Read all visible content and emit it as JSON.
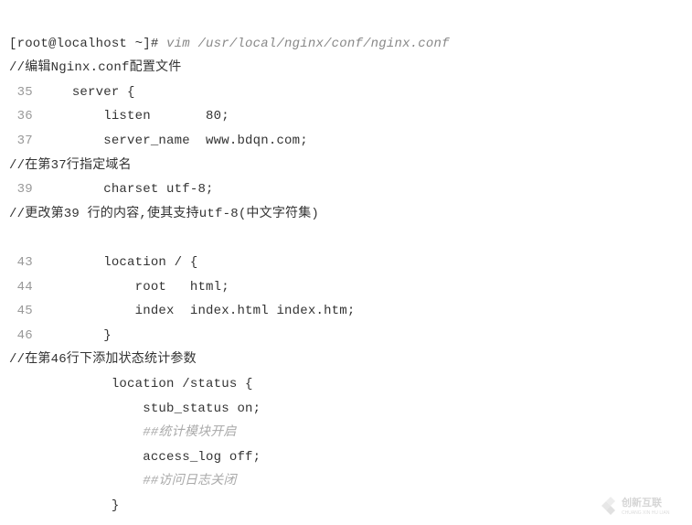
{
  "prompt": {
    "userHost": "[root@localhost ~]",
    "symbol": "#",
    "command": " vim /usr/local/nginx/conf/nginx.conf"
  },
  "comments": {
    "c1": "//编辑Nginx.conf配置文件",
    "c2": "//在第37行指定域名",
    "c3": "//更改第39 行的内容,使其支持utf-8(中文字符集)",
    "c4": "//在第46行下添加状态统计参数",
    "ic1": "##统计模块开启",
    "ic2": "##访问日志关闭"
  },
  "codeLines": {
    "l35": {
      "num": " 35",
      "content": "     server {"
    },
    "l36": {
      "num": " 36",
      "content": "         listen       80;"
    },
    "l37": {
      "num": " 37",
      "content": "         server_name  www.bdqn.com;"
    },
    "l39": {
      "num": " 39",
      "content": "         charset utf-8;"
    },
    "l43": {
      "num": " 43",
      "content": "         location / {"
    },
    "l44": {
      "num": " 44",
      "content": "             root   html;"
    },
    "l45": {
      "num": " 45",
      "content": "             index  index.html index.htm;"
    },
    "l46": {
      "num": " 46",
      "content": "         }"
    },
    "status1": "             location /status {",
    "status2": "                 stub_status on;",
    "status3": "                 access_log off;",
    "status4": "             }"
  },
  "watermark": {
    "text1": "创新互联",
    "text2": "CHUANG XIN HU LIAN"
  }
}
